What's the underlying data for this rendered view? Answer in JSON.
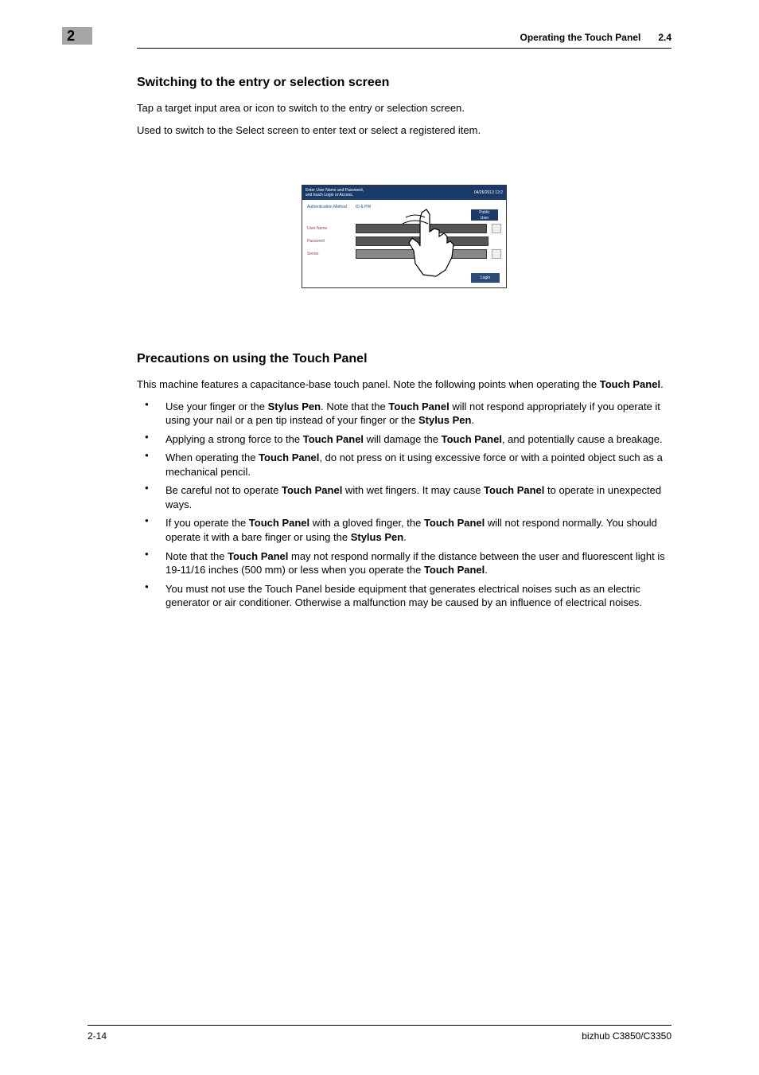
{
  "chapter_number": "2",
  "header": {
    "title": "Operating the Touch Panel",
    "section_num": "2.4"
  },
  "section1": {
    "heading": "Switching to the entry or selection screen",
    "p1": "Tap a target input area or icon to switch to the entry or selection screen.",
    "p2": "Used to switch to the Select screen to enter text or select a registered item."
  },
  "figure": {
    "title_left": "Enter User Name and Password,\nand touch Login or Access.",
    "title_right": "04/26/2013 13:2",
    "label_auth": "Authentication Method",
    "label_idpw": "ID & PW",
    "label_user": "User Name",
    "label_pass": "Password",
    "label_server": "Server",
    "public_user": "Public\nUser",
    "login": "Login"
  },
  "section2": {
    "heading": "Precautions on using the Touch Panel",
    "intro_pre": "This machine features a capacitance-base touch panel. Note the following points when operating the ",
    "intro_bold": "Touch Panel",
    "intro_post": ".",
    "bullets": [
      {
        "pre": "Use your finger or the ",
        "b1": "Stylus Pen",
        "mid1": ". Note that the ",
        "b2": "Touch Panel",
        "mid2": " will not respond appropriately if you operate it using your nail or a pen tip instead of your finger or the ",
        "b3": "Stylus Pen",
        "post": "."
      },
      {
        "pre": "Applying a strong force to the ",
        "b1": "Touch Panel",
        "mid1": " will damage the ",
        "b2": "Touch Panel",
        "post": ", and potentially cause a breakage."
      },
      {
        "pre": "When operating the ",
        "b1": "Touch Panel",
        "post": ", do not press on it using excessive force or with a pointed object such as a mechanical pencil."
      },
      {
        "pre": "Be careful not to operate ",
        "b1": "Touch Panel",
        "mid1": " with wet fingers. It may cause ",
        "b2": "Touch Panel",
        "post": " to operate in unexpected ways."
      },
      {
        "pre": "If you operate the ",
        "b1": "Touch Panel",
        "mid1": " with a gloved finger, the ",
        "b2": "Touch Panel",
        "mid2": " will not respond normally. You should operate it with a bare finger or using the ",
        "b3": "Stylus Pen",
        "post": "."
      },
      {
        "pre": "Note that the ",
        "b1": "Touch Panel",
        "mid1": " may not respond normally if the distance between the user and fluorescent light is 19-11/16 inches (500 mm) or less when you operate the ",
        "b2": "Touch Panel",
        "post": "."
      },
      {
        "pre": "You must not use the Touch Panel beside equipment that generates electrical noises such as an electric generator or air conditioner. Otherwise a malfunction may be caused by an influence of electrical noises."
      }
    ]
  },
  "footer": {
    "page": "2-14",
    "model": "bizhub C3850/C3350"
  }
}
